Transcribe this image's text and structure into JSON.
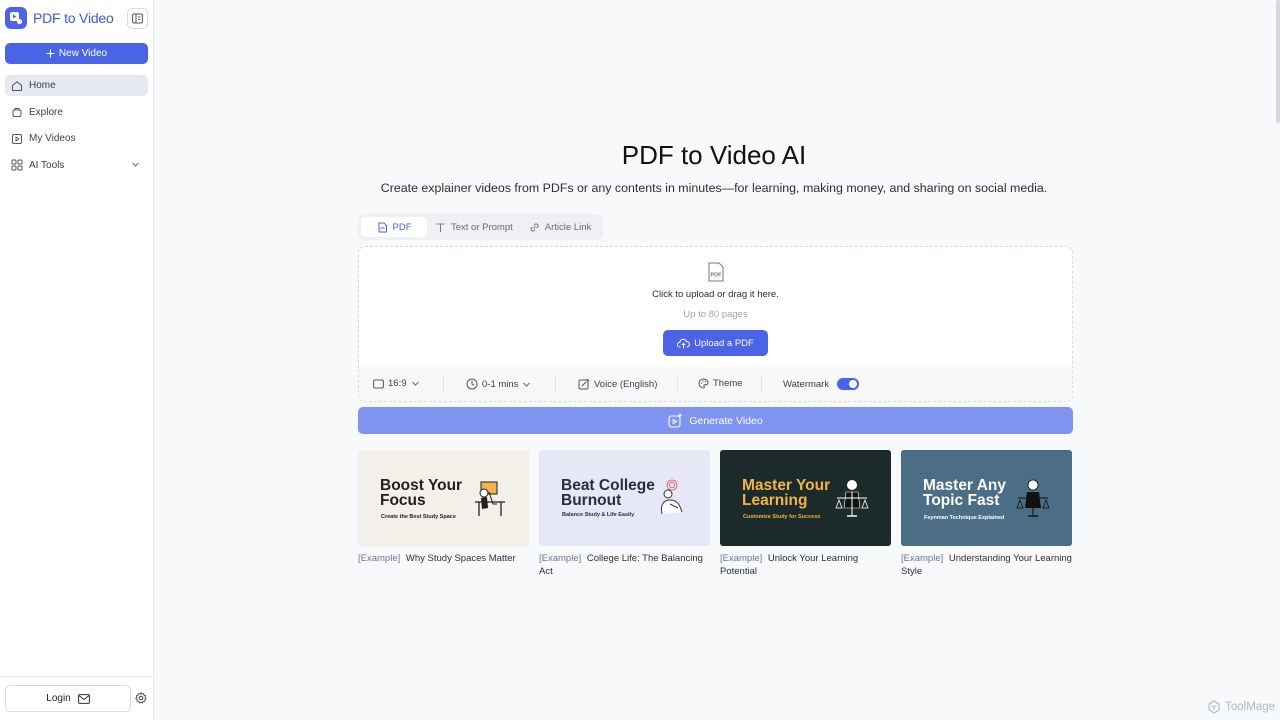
{
  "sidebar": {
    "brand": "PDF to Video",
    "new_video": "New Video",
    "items": [
      {
        "label": "Home",
        "icon": "home-icon"
      },
      {
        "label": "Explore",
        "icon": "explore-icon"
      },
      {
        "label": "My Videos",
        "icon": "video-icon"
      },
      {
        "label": "AI Tools",
        "icon": "grid-icon"
      }
    ],
    "login": "Login"
  },
  "main": {
    "title": "PDF to Video AI",
    "subtitle": "Create explainer videos from PDFs or any contents in minutes—for learning, making money, and sharing on social media.",
    "tabs": [
      {
        "label": "PDF",
        "active": true
      },
      {
        "label": "Text or Prompt",
        "active": false
      },
      {
        "label": "Article Link",
        "active": false
      }
    ],
    "upload": {
      "prompt": "Click to upload or drag it here.",
      "hint": "Up to 80 pages",
      "button": "Upload a PDF"
    },
    "options": {
      "ratio": "16:9",
      "duration": "0-1 mins",
      "voice": "Voice (English)",
      "theme": "Theme",
      "watermark": "Watermark",
      "watermark_on": true
    },
    "generate": "Generate Video",
    "examples": [
      {
        "thumb_title_1": "Boost Your",
        "thumb_title_2": "Focus",
        "thumb_sub": "Create the Best Study Space",
        "tag": "[Example]",
        "caption": "Why Study Spaces Matter"
      },
      {
        "thumb_title_1": "Beat College",
        "thumb_title_2": "Burnout",
        "thumb_sub": "Balance Study & Life Easily",
        "tag": "[Example]",
        "caption": "College Life: The Balancing Act"
      },
      {
        "thumb_title_1": "Master Your",
        "thumb_title_2": "Learning",
        "thumb_sub": "Customize Study for Success",
        "tag": "[Example]",
        "caption": "Unlock Your Learning Potential"
      },
      {
        "thumb_title_1": "Master Any",
        "thumb_title_2": "Topic Fast",
        "thumb_sub": "Feynman Technique Explained",
        "tag": "[Example]",
        "caption": "Understanding Your Learning Style"
      }
    ]
  },
  "watermark_brand": "ToolMage",
  "colors": {
    "accent": "#4a63e7",
    "generate_disabled": "#7f93f0",
    "card1_bg": "#f3efe9",
    "card2_bg": "#e6e8f8",
    "card3_bg": "#1c2b2a",
    "card4_bg": "#4b6d86"
  }
}
